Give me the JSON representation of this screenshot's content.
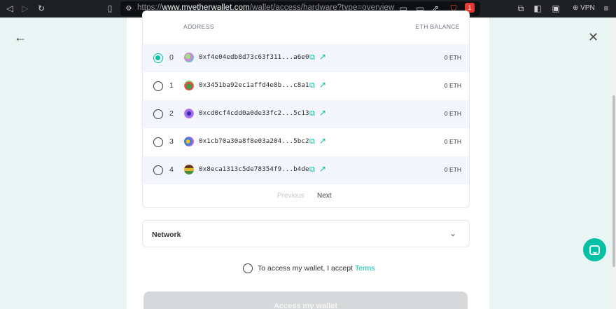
{
  "browser": {
    "url_domain": "www.myetherwallet.com",
    "url_prefix": "https://",
    "url_path": "/wallet/access/hardware?type=overview",
    "vpn_label": "VPN",
    "brave_badge": "1"
  },
  "table": {
    "col_address": "ADDRESS",
    "col_balance": "ETH BALANCE",
    "rows": [
      {
        "index": "0",
        "address": "0xf4e04edb8d73c63f311...a6e0",
        "balance": "0 ETH",
        "selected": true
      },
      {
        "index": "1",
        "address": "0x3451ba92ec1affd4e8b...c8a1",
        "balance": "0 ETH",
        "selected": false
      },
      {
        "index": "2",
        "address": "0xcd0cf4cdd0a0de33fc2...5c13",
        "balance": "0 ETH",
        "selected": false
      },
      {
        "index": "3",
        "address": "0x1cb70a30a8f8e03a204...5bc2",
        "balance": "0 ETH",
        "selected": false
      },
      {
        "index": "4",
        "address": "0x8eca1313c5de78354f9...b4de",
        "balance": "0 ETH",
        "selected": false
      }
    ],
    "prev_label": "Previous",
    "next_label": "Next"
  },
  "network": {
    "label": "Network"
  },
  "terms": {
    "text": "To access my wallet, I accept",
    "link": "Terms"
  },
  "access_button": "Access my wallet",
  "colors": {
    "accent": "#05c0a5",
    "row_alt": "#f2f6fc",
    "page_bg": "#e9f5f2"
  },
  "icons": [
    "back-arrow-icon",
    "close-icon",
    "copy-icon",
    "external-link-icon",
    "chevron-down-icon",
    "chat-icon"
  ]
}
